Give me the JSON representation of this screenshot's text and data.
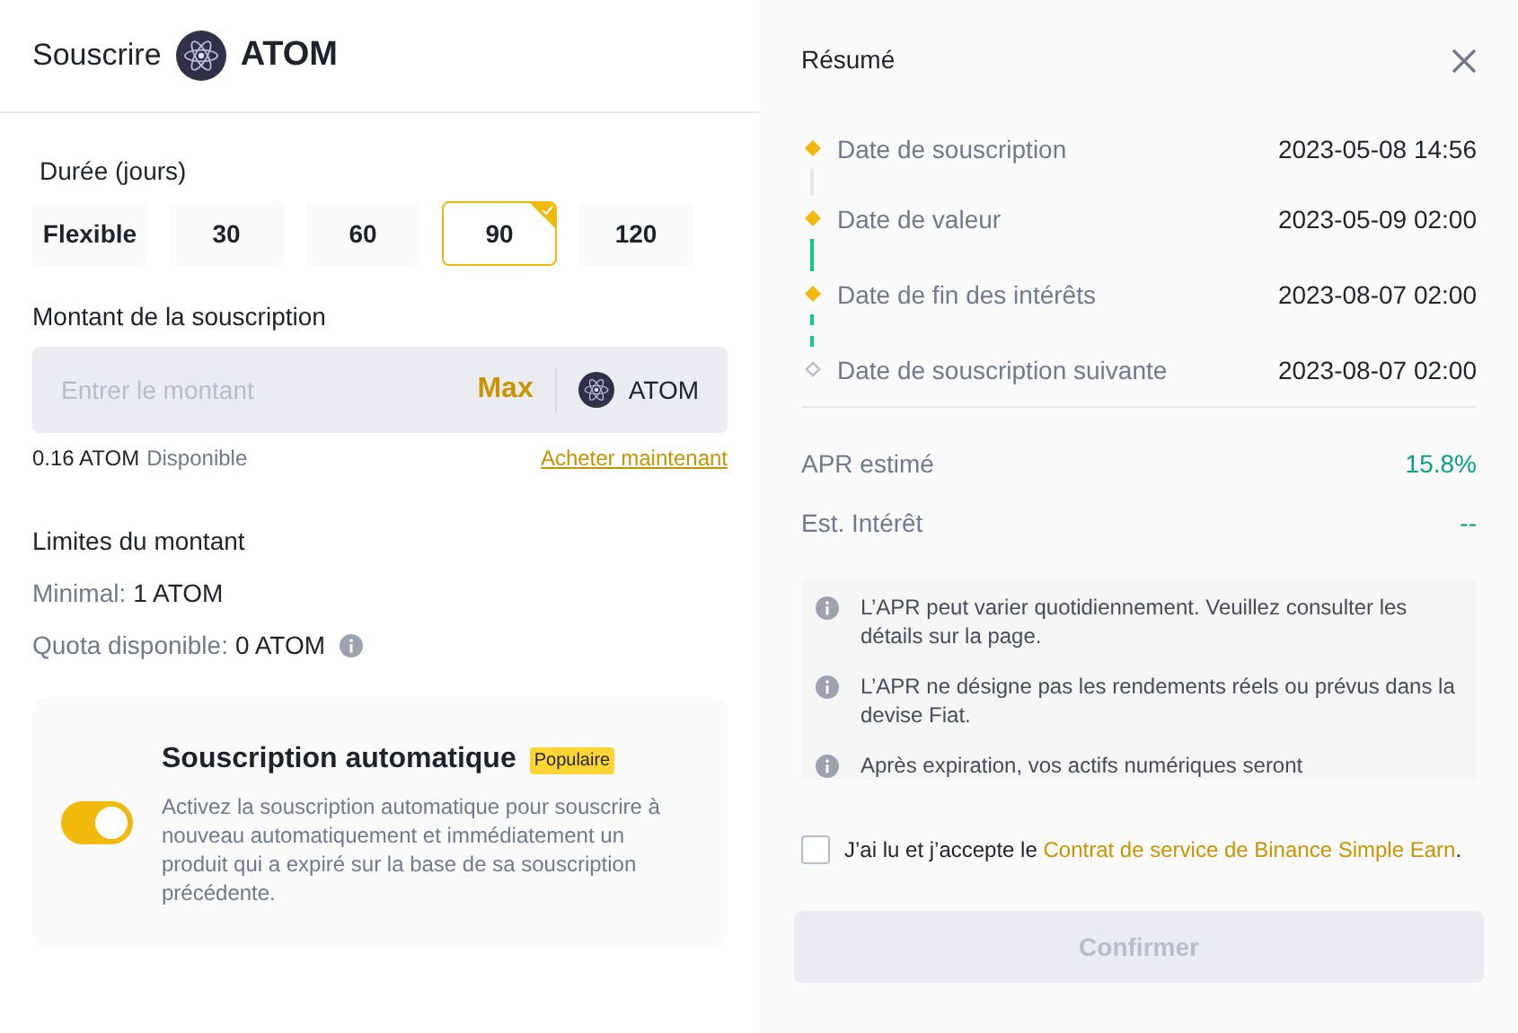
{
  "header": {
    "title": "Souscrire",
    "asset": "ATOM"
  },
  "duration": {
    "label": "Durée (jours)",
    "options": [
      {
        "label": "Flexible",
        "selected": false
      },
      {
        "label": "30",
        "selected": false
      },
      {
        "label": "60",
        "selected": false
      },
      {
        "label": "90",
        "selected": true
      },
      {
        "label": "120",
        "selected": false
      }
    ]
  },
  "amount": {
    "label": "Montant de la souscription",
    "placeholder": "Entrer le montant",
    "max": "Max",
    "asset": "ATOM",
    "balance": "0.16 ATOM",
    "balance_label": "Disponible",
    "buy_link": "Acheter maintenant"
  },
  "limits": {
    "title": "Limites du montant",
    "rows": [
      {
        "label": "Minimal:",
        "value": "1 ATOM",
        "info": false
      },
      {
        "label": "Quota disponible:",
        "value": "0 ATOM",
        "info": true
      }
    ]
  },
  "auto_subscribe": {
    "title": "Souscription automatique",
    "badge": "Populaire",
    "description": "Activez la souscription automatique pour souscrire à nouveau automatiquement et immédiatement un produit qui a expiré sur la base de sa souscription précédente.",
    "on": true
  },
  "summary": {
    "title": "Résumé",
    "timeline": [
      {
        "label": "Date de souscription",
        "value": "2023-05-08 14:56",
        "reached": true,
        "kind": "grey"
      },
      {
        "label": "Date de valeur",
        "value": "2023-05-09 02:00",
        "reached": true,
        "kind": "green"
      },
      {
        "label": "Date de fin des intérêts",
        "value": "2023-08-07 02:00",
        "reached": true,
        "kind": "dashed"
      },
      {
        "label": "Date de souscription suivante",
        "value": "2023-08-07 02:00",
        "reached": false,
        "kind": "end"
      }
    ],
    "stats": [
      {
        "label": "APR estimé",
        "value": "15.8%"
      },
      {
        "label": "Est. Intérêt",
        "value": "--"
      }
    ],
    "notes": [
      "L’APR peut varier quotidiennement. Veuillez consulter les détails sur la page.",
      "L’APR ne désigne pas les rendements réels ou prévus dans la devise Fiat.",
      "Après expiration, vos actifs numériques seront"
    ],
    "agreement": {
      "text": "J’ai lu et j’accepte le",
      "link": "Contrat de service de Binance Simple Earn",
      "end": ".",
      "checked": false
    },
    "confirm": {
      "label": "Confirmer",
      "disabled": true
    }
  }
}
